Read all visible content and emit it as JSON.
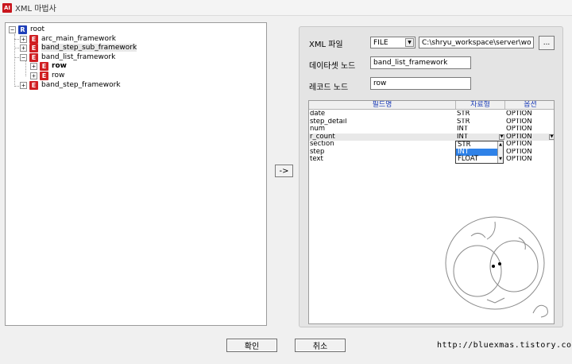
{
  "window": {
    "icon_label": "AI",
    "title": "XML 마법사"
  },
  "tree": {
    "nodes": [
      {
        "label": "root",
        "type": "R",
        "expander": "−",
        "bold": false,
        "selected": false
      },
      {
        "label": "arc_main_framework",
        "type": "E",
        "expander": "+",
        "bold": false,
        "selected": false
      },
      {
        "label": "band_step_sub_framework",
        "type": "E",
        "expander": "+",
        "bold": false,
        "selected": true
      },
      {
        "label": "band_list_framework",
        "type": "E",
        "expander": "−",
        "bold": false,
        "selected": false
      },
      {
        "label": "row",
        "type": "E",
        "expander": "+",
        "bold": true,
        "selected": false
      },
      {
        "label": "row",
        "type": "E",
        "expander": "+",
        "bold": false,
        "selected": false
      },
      {
        "label": "band_step_framework",
        "type": "E",
        "expander": "+",
        "bold": false,
        "selected": false
      }
    ]
  },
  "arrow_button": "->",
  "form": {
    "xml_file_label": "XML 파일",
    "source_type": "FILE",
    "file_path": "C:\\shryu_workspace\\server\\wo",
    "browse_label": "...",
    "dataset_node_label": "데이타셋 노드",
    "dataset_node_value": "band_list_framework",
    "record_node_label": "레코드 노드",
    "record_node_value": "row"
  },
  "grid": {
    "headers": [
      "필드명",
      "자료형",
      "옵션"
    ],
    "rows": [
      {
        "field": "date",
        "type": "STR",
        "option": "OPTION"
      },
      {
        "field": "step_detail",
        "type": "STR",
        "option": "OPTION"
      },
      {
        "field": "num",
        "type": "INT",
        "option": "OPTION"
      },
      {
        "field": "r_count",
        "type": "INT",
        "option": "OPTION"
      },
      {
        "field": "section",
        "type": "",
        "option": "OPTION"
      },
      {
        "field": "step",
        "type": "",
        "option": "OPTION"
      },
      {
        "field": "text",
        "type": "",
        "option": "OPTION"
      }
    ],
    "type_options": [
      "STR",
      "INT",
      "FLOAT"
    ],
    "highlighted_option": "INT"
  },
  "buttons": {
    "ok": "확인",
    "cancel": "취소"
  },
  "blog_url": "http://bluexmas.tistory.com/"
}
